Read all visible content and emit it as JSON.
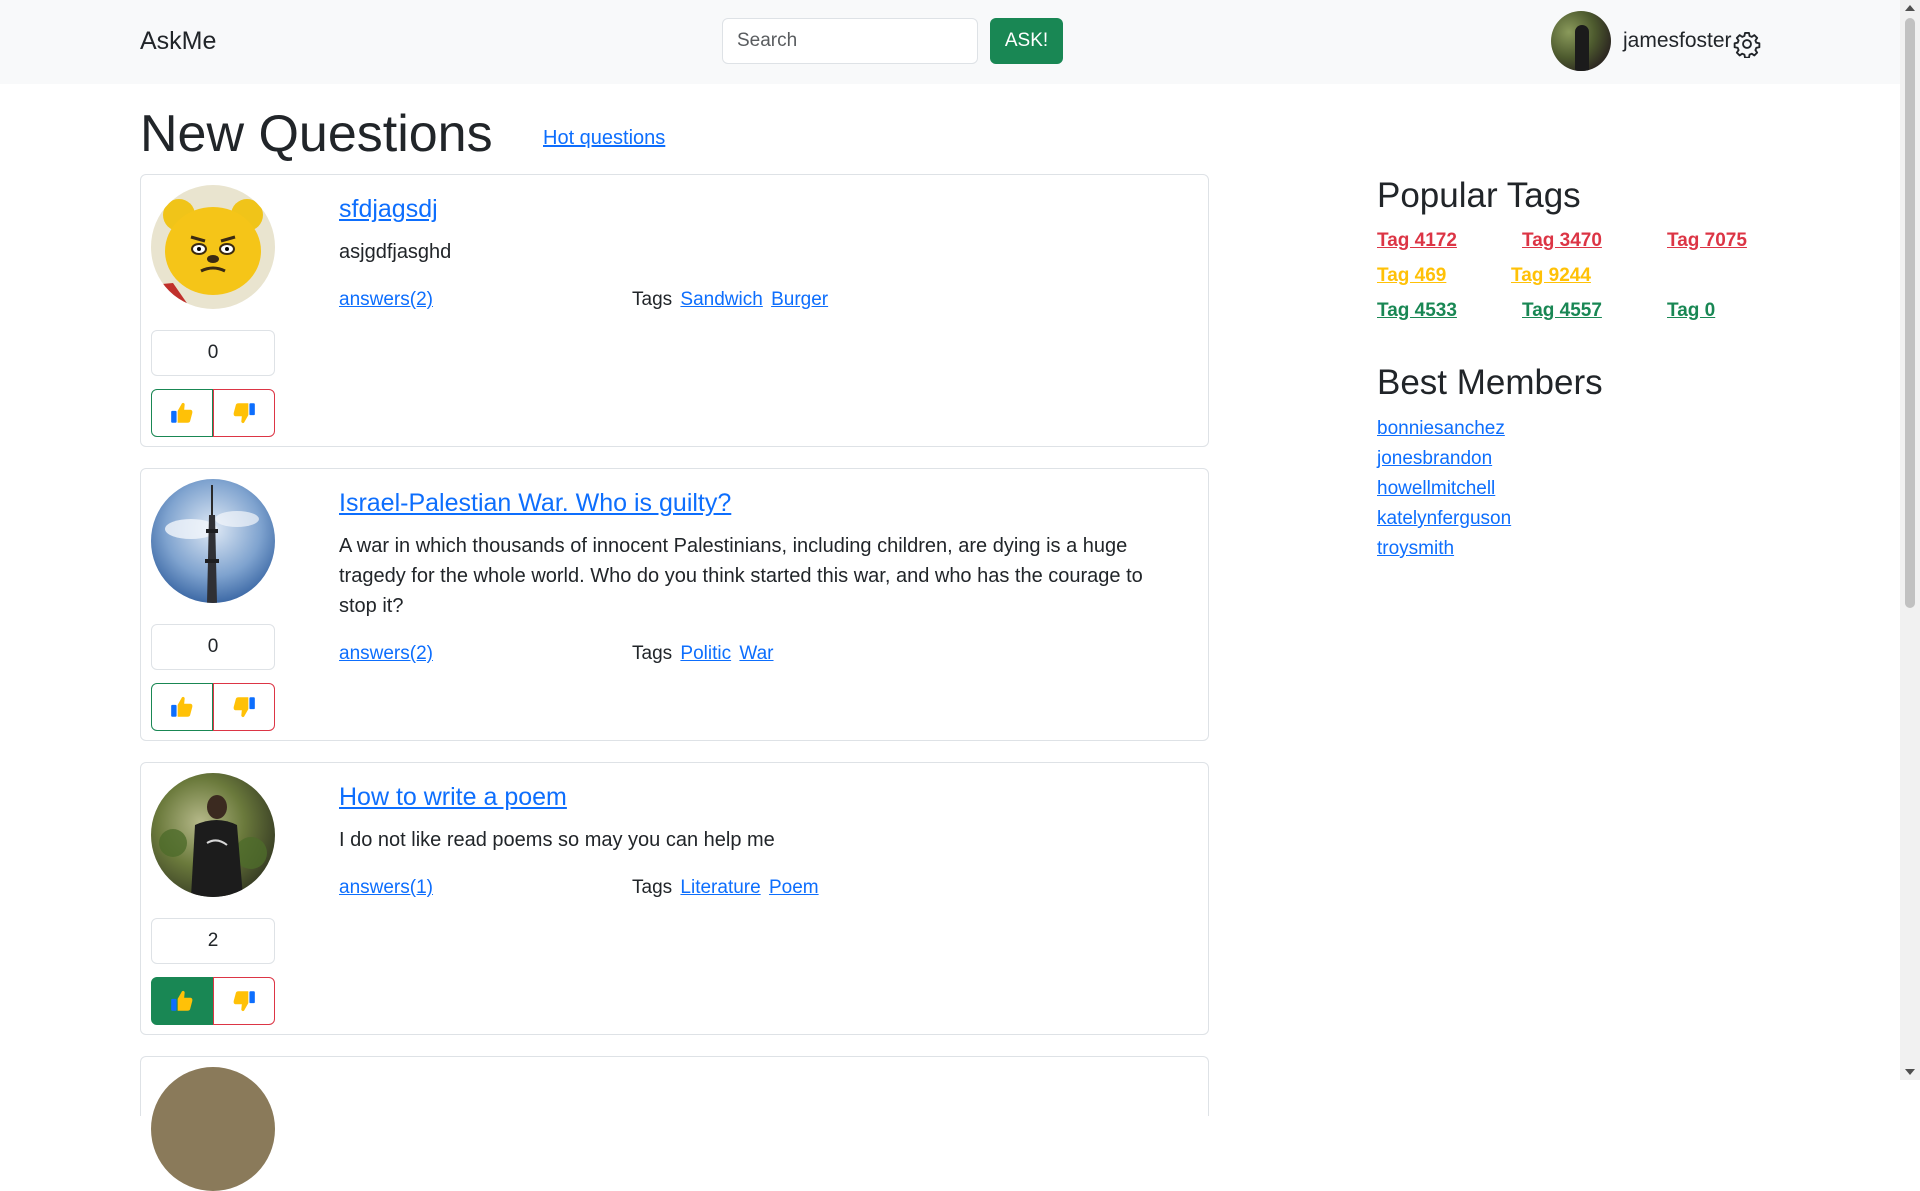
{
  "navbar": {
    "brand": "AskMe",
    "search_placeholder": "Search",
    "ask_label": "ASK!",
    "username": "jamesfoster"
  },
  "main": {
    "title": "New Questions",
    "hot_link": "Hot questions",
    "questions": [
      {
        "title": "sfdjagsdj",
        "text": "asjgdfjasghd",
        "votes": "0",
        "answers": "answers(2)",
        "tags_label": "Tags",
        "tags": [
          "Sandwich",
          "Burger"
        ],
        "liked": false
      },
      {
        "title": "Israel-Palestian War. Who is guilty?",
        "text": "A war in which thousands of innocent Palestinians, including children, are dying is a huge tragedy for the whole world. Who do you think started this war, and who has the courage to stop it?",
        "votes": "0",
        "answers": "answers(2)",
        "tags_label": "Tags",
        "tags": [
          "Politic",
          "War"
        ],
        "liked": false
      },
      {
        "title": "How to write a poem",
        "text": "I do not like read poems so may you can help me",
        "votes": "2",
        "answers": "answers(1)",
        "tags_label": "Tags",
        "tags": [
          "Literature",
          "Poem"
        ],
        "liked": true
      }
    ]
  },
  "sidebar": {
    "popular_tags_title": "Popular Tags",
    "popular_tags": [
      {
        "label": "Tag 4172",
        "color": "#dc3545"
      },
      {
        "label": "Tag 3470",
        "color": "#dc3545"
      },
      {
        "label": "Tag 7075",
        "color": "#dc3545"
      },
      {
        "label": "Tag 469",
        "color": "#ffc107"
      },
      {
        "label": "Tag 9244",
        "color": "#ffc107"
      },
      {
        "label": "Tag 4533",
        "color": "#198754"
      },
      {
        "label": "Tag 4557",
        "color": "#198754"
      },
      {
        "label": "Tag 0",
        "color": "#198754"
      }
    ],
    "best_members_title": "Best Members",
    "best_members": [
      "bonniesanchez",
      "jonesbrandon",
      "howellmitchell",
      "katelynferguson",
      "troysmith"
    ]
  },
  "colors": {
    "success": "#198754",
    "danger": "#dc3545",
    "warning": "#ffc107",
    "link": "#0d6efd",
    "thumb_blue": "#0d6efd",
    "thumb_yellow": "#ffc107"
  }
}
